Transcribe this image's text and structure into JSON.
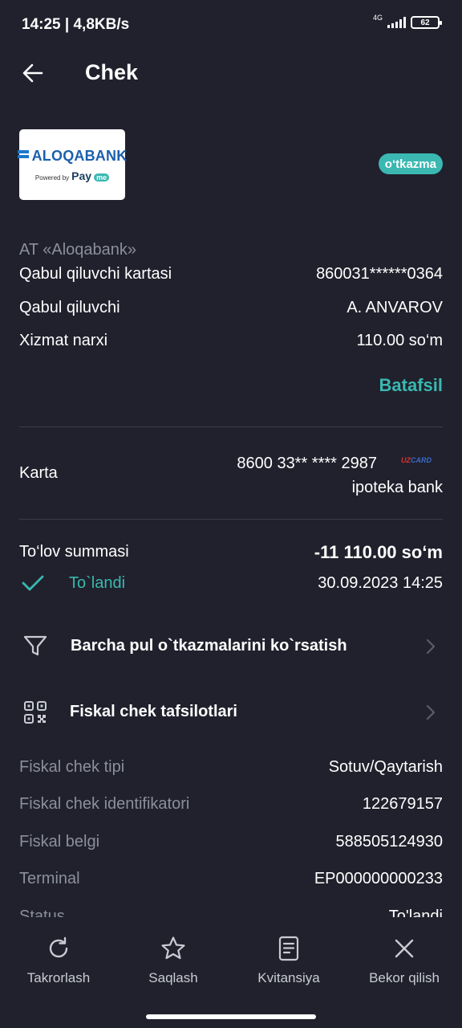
{
  "status_bar": {
    "time_speed": "14:25 | 4,8KB/s",
    "network": "4G",
    "battery": "62"
  },
  "header": {
    "title": "Chek",
    "back_icon": "arrow-left-icon"
  },
  "merchant": {
    "logo_name": "ALOQABANK",
    "logo_powered": "Powered by",
    "logo_pay": "Pay",
    "logo_me": "me",
    "badge": "o‘tkazma",
    "company": "AT «Aloqabank»"
  },
  "details": [
    {
      "label": "Qabul qiluvchi kartasi",
      "value": "860031******0364"
    },
    {
      "label": "Qabul qiluvchi",
      "value": "A. ANVAROV"
    },
    {
      "label": "Xizmat narxi",
      "value": "110.00 so‘m"
    }
  ],
  "more_link": "Batafsil",
  "card": {
    "label": "Karta",
    "number": "8600 33** **** 2987",
    "bank": "ipoteka bank",
    "system_prefix": "UZ",
    "system": "CARD"
  },
  "payment": {
    "label": "To‘lov summasi",
    "amount": "-11 110.00 so‘m",
    "status": "To`landi",
    "datetime": "30.09.2023 14:25"
  },
  "actions": [
    {
      "label": "Barcha pul o`tkazmalarini ko`rsatish",
      "icon": "filter-icon"
    },
    {
      "label": "Fiskal chek tafsilotlari",
      "icon": "qr-code-icon"
    }
  ],
  "fiscal": [
    {
      "label": "Fiskal chek tipi",
      "value": "Sotuv/Qaytarish"
    },
    {
      "label": "Fiskal chek identifikatori",
      "value": "122679157"
    },
    {
      "label": "Fiskal belgi",
      "value": "588505124930"
    },
    {
      "label": "Terminal",
      "value": "EP000000000233"
    },
    {
      "label": "Status",
      "value": "To'landi"
    }
  ],
  "bottom_nav": [
    {
      "label": "Takrorlash",
      "icon": "refresh-icon"
    },
    {
      "label": "Saqlash",
      "icon": "star-icon"
    },
    {
      "label": "Kvitansiya",
      "icon": "document-icon"
    },
    {
      "label": "Bekor qilish",
      "icon": "close-icon"
    }
  ],
  "colors": {
    "background": "#20212c",
    "accent": "#3ab8b1",
    "muted": "#8c8f9c"
  }
}
